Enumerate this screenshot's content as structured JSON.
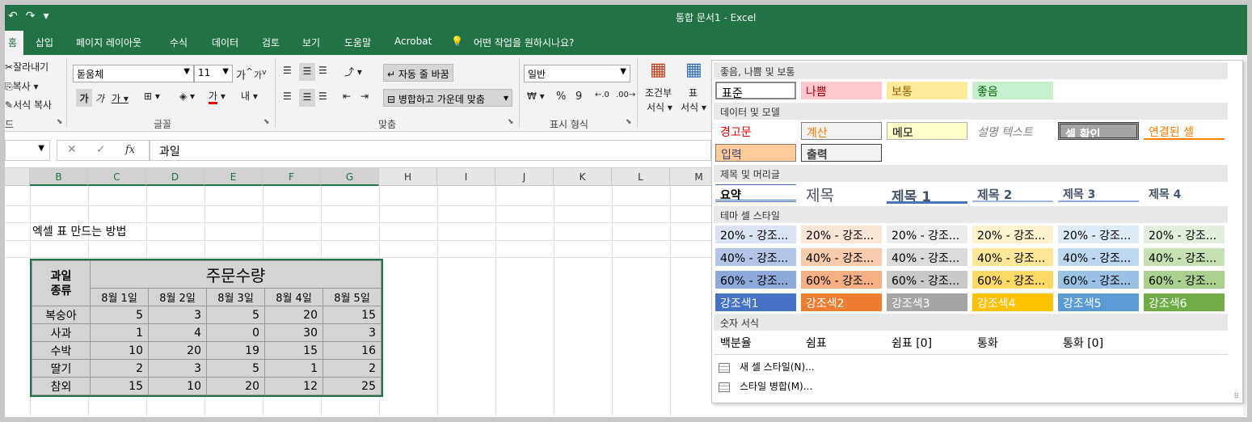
{
  "title_bar": {
    "title": "통합 문서1 - Excel",
    "qat": [
      "↶",
      "↷",
      "▾"
    ]
  },
  "tabs": [
    {
      "label": "홈",
      "active": true
    },
    {
      "label": "삽입"
    },
    {
      "label": "페이지 레이아웃"
    },
    {
      "label": "수식"
    },
    {
      "label": "데이터"
    },
    {
      "label": "검토"
    },
    {
      "label": "보기"
    },
    {
      "label": "도움말"
    },
    {
      "label": "Acrobat"
    },
    {
      "label": "어떤 작업을 원하시나요?"
    }
  ],
  "ribbon": {
    "clipboard": {
      "cut": "잘라내기",
      "copy": "복사",
      "format_painter": "서식 복사",
      "label": "드"
    },
    "font": {
      "name": "돋움체",
      "size": "11",
      "grow": "가",
      "shrink": "가",
      "bold": "가",
      "italic": "가",
      "underline": "가",
      "phonetic": "내",
      "font_color": "가",
      "label": "글꼴"
    },
    "alignment": {
      "wrap": "자동 줄 바꿈",
      "merge": "병합하고 가운데 맞춤",
      "label": "맞춤"
    },
    "number": {
      "format": "일반",
      "percent": "%",
      "comma": "9",
      "label": "표시 형식"
    },
    "styles": {
      "conditional": [
        "조건부",
        "서식"
      ],
      "table": [
        "표",
        "서식"
      ]
    }
  },
  "formula_bar": {
    "fx": "fx",
    "cancel": "✕",
    "enter": "✓",
    "value": "과일"
  },
  "columns": [
    "B",
    "C",
    "D",
    "E",
    "F",
    "G",
    "H",
    "I",
    "J",
    "K",
    "L",
    "M"
  ],
  "sheet": {
    "heading": "엑셀 표 만드는 방법",
    "table": {
      "corner": [
        "과일",
        "종류"
      ],
      "group_header": "주문수량",
      "dates": [
        "8월  1일",
        "8월  2일",
        "8월  3일",
        "8월  4일",
        "8월  5일"
      ],
      "rows": [
        {
          "name": "복숭아",
          "values": [
            "5",
            "3",
            "5",
            "20",
            "15"
          ]
        },
        {
          "name": "사과",
          "values": [
            "1",
            "4",
            "0",
            "30",
            "3"
          ]
        },
        {
          "name": "수박",
          "values": [
            "10",
            "20",
            "19",
            "15",
            "16"
          ]
        },
        {
          "name": "딸기",
          "values": [
            "2",
            "3",
            "5",
            "1",
            "2"
          ]
        },
        {
          "name": "참외",
          "values": [
            "15",
            "10",
            "20",
            "12",
            "25"
          ]
        }
      ]
    }
  },
  "styles_panel": {
    "sections": {
      "good_bad": "좋음, 나쁨 및 보통",
      "data_model": "데이터 및 모델",
      "titles": "제목 및 머리글",
      "theme": "테마 셀 스타일",
      "number": "숫자 서식"
    },
    "good_bad": [
      "표준",
      "나쁨",
      "보통",
      "좋음"
    ],
    "data_model_row1": [
      "경고문",
      "계산",
      "메모",
      "설명 텍스트",
      "셀 확인",
      "연결된 셀"
    ],
    "data_model_row2": [
      "입력",
      "출력"
    ],
    "titles": [
      "요약",
      "제목",
      "제목 1",
      "제목 2",
      "제목 3",
      "제목 4"
    ],
    "theme_20": [
      "20% - 강조...",
      "20% - 강조...",
      "20% - 강조...",
      "20% - 강조...",
      "20% - 강조...",
      "20% - 강조..."
    ],
    "theme_40": [
      "40% - 강조...",
      "40% - 강조...",
      "40% - 강조...",
      "40% - 강조...",
      "40% - 강조...",
      "40% - 강조..."
    ],
    "theme_60": [
      "60% - 강조...",
      "60% - 강조...",
      "60% - 강조...",
      "60% - 강조...",
      "60% - 강조...",
      "60% - 강조..."
    ],
    "accents": [
      "강조색1",
      "강조색2",
      "강조색3",
      "강조색4",
      "강조색5",
      "강조색6"
    ],
    "number_styles": [
      "백분율",
      "쉼표",
      "쉼표 [0]",
      "통화",
      "통화 [0]"
    ],
    "menu": {
      "new_style": "새 셀 스타일(N)...",
      "merge_styles": "스타일 병합(M)..."
    }
  },
  "colors": {
    "excel_green": "#217346"
  }
}
